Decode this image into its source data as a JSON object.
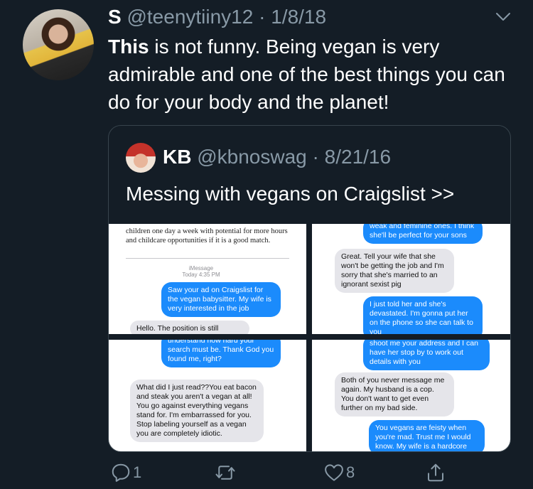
{
  "tweet": {
    "display_name": "S",
    "handle": "@teenytiiny12",
    "date": "1/8/18",
    "text_bold": "This",
    "text_rest": " is not funny. Being vegan is very admirable and one of the best things you can do for your body and the planet!"
  },
  "quote": {
    "display_name": "KB",
    "handle": "@kbnoswag",
    "date": "8/21/16",
    "text": "Messing with vegans on Craigslist >>"
  },
  "screenshot1": {
    "ad_line1": "children one day a week with potential for more hours",
    "ad_line2": "and childcare opportunities if it is a good match.",
    "imessage_label": "iMessage",
    "imessage_time": "Today 4:35 PM",
    "sent": "Saw your ad on Craigslist for the vegan babysitter. My wife is very interested in the job",
    "received": "Hello. The position is still"
  },
  "screenshot2": {
    "top_sent": "weak and feminine ones. I think she'll be perfect for your sons",
    "received": "Great.  Tell your wife that she won't be getting the job and I'm sorry that she's married to an ignorant sexist pig",
    "sent": "I just told her and she's devastated. I'm gonna put her on the phone so she can talk to you"
  },
  "screenshot3": {
    "top_sent": "understand how hard your search must be. Thank God you found me, right?",
    "received": "What did I just read??You eat bacon and steak you aren't a vegan at all! You go against everything vegans stand for. I'm embarrassed for you. Stop labeling yourself as a vegan you are completely idiotic."
  },
  "screenshot4": {
    "top_sent": "shoot me your address and I can have her stop by to work out details with you",
    "received": "Both of you never message me again. My husband is a cop. You don't want to get even further on my bad side.",
    "sent": "You vegans are feisty when you're mad. Trust me I would know. My wife is a hardcore"
  },
  "actions": {
    "reply_count": "1",
    "retweet_count": "",
    "like_count": "8",
    "reply_icon": "reply-icon",
    "retweet_icon": "retweet-icon",
    "like_icon": "heart-icon",
    "share_icon": "share-icon"
  },
  "colors": {
    "background": "#141d26",
    "secondary_text": "#8899a6",
    "imessage_blue": "#1b8bfc",
    "imessage_grey": "#e5e5ea"
  }
}
